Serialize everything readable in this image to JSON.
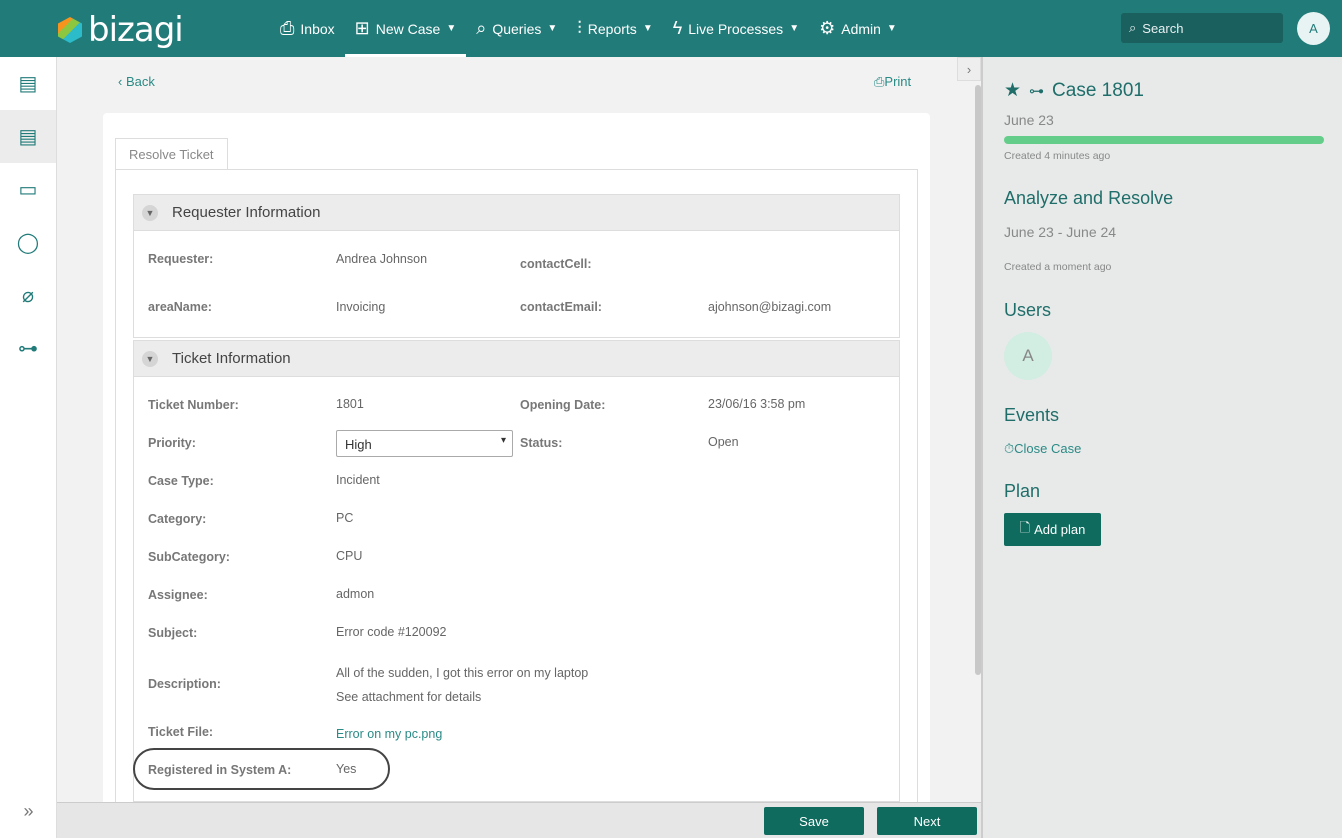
{
  "header": {
    "logo": "bizagi",
    "nav": [
      {
        "label": "Inbox",
        "icon": "inbox-icon",
        "g": "⎙",
        "dd": false
      },
      {
        "label": "New Case",
        "icon": "new-case-icon",
        "g": "⊞",
        "dd": true
      },
      {
        "label": "Queries",
        "icon": "search-icon",
        "g": "⌕",
        "dd": true
      },
      {
        "label": "Reports",
        "icon": "chart-icon",
        "g": "⫶",
        "dd": true
      },
      {
        "label": "Live Processes",
        "icon": "bolt-icon",
        "g": "ϟ",
        "dd": true
      },
      {
        "label": "Admin",
        "icon": "gear-icon",
        "g": "⚙",
        "dd": true
      }
    ],
    "search_placeholder": "Search",
    "avatar": "A"
  },
  "toolbar": {
    "back": "Back",
    "print": "Print"
  },
  "form": {
    "tab": "Resolve Ticket",
    "requester": {
      "title": "Requester Information",
      "requester_label": "Requester:",
      "requester": "Andrea Johnson",
      "contactCell_label": "contactCell:",
      "area_label": "areaName:",
      "area": "Invoicing",
      "email_label": "contactEmail:",
      "email": "ajohnson@bizagi.com"
    },
    "ticket": {
      "title": "Ticket Information",
      "number_label": "Ticket Number:",
      "number": "1801",
      "opening_label": "Opening Date:",
      "opening": "23/06/16 3:58 pm",
      "priority_label": "Priority:",
      "priority": "High",
      "status_label": "Status:",
      "status": "Open",
      "casetype_label": "Case Type:",
      "casetype": "Incident",
      "category_label": "Category:",
      "category": "PC",
      "subcategory_label": "SubCategory:",
      "subcategory": "CPU",
      "assignee_label": "Assignee:",
      "assignee": "admon",
      "subject_label": "Subject:",
      "subject": "Error code #120092",
      "description_label": "Description:",
      "description1": "All of the sudden, I got this error on my laptop",
      "description2": "See attachment for details",
      "file_label": "Ticket File:",
      "file": "Error on my pc.png",
      "registered_label": "Registered in System A:",
      "registered": "Yes"
    }
  },
  "footer": {
    "save": "Save",
    "next": "Next"
  },
  "panel": {
    "case": "Case 1801",
    "case_date": "June 23",
    "case_progress": 100,
    "case_created": "Created 4 minutes ago",
    "task": "Analyze and Resolve",
    "task_dates": "June 23 - June 24",
    "task_created": "Created a moment ago",
    "users_title": "Users",
    "user_avatar": "A",
    "events_title": "Events",
    "close_case": "Close Case",
    "plan_title": "Plan",
    "add_plan": "Add plan"
  },
  "colors": {
    "header": "#217b79",
    "accent": "#0e6b5e",
    "progress": "#64cd89"
  }
}
